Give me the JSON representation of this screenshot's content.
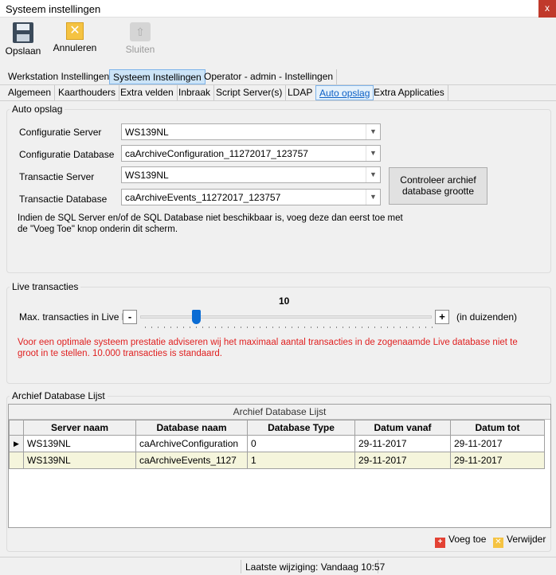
{
  "window": {
    "title": "Systeem instellingen",
    "close_glyph": "x"
  },
  "toolbar": {
    "save": {
      "label": "Opslaan",
      "icon": "save-icon"
    },
    "cancel": {
      "label": "Annuleren",
      "icon": "cancel-icon"
    },
    "close": {
      "label": "Sluiten",
      "icon": "close-icon",
      "disabled": true
    }
  },
  "main_tabs": [
    "Werkstation Instellingen",
    "Systeem Instellingen",
    "Operator - admin - Instellingen"
  ],
  "main_tab_active": "Systeem Instellingen",
  "sub_tabs": [
    "Algemeen",
    "Kaarthouders",
    "Extra velden",
    "Inbraak",
    "Script Server(s)",
    "LDAP",
    "Auto opslag",
    "Extra Applicaties"
  ],
  "sub_tab_active": "Auto opslag",
  "auto_opslag": {
    "title": "Auto opslag",
    "config_server_label": "Configuratie Server",
    "config_server_value": "WS139NL",
    "config_db_label": "Configuratie Database",
    "config_db_value": "caArchiveConfiguration_11272017_123757",
    "trans_server_label": "Transactie Server",
    "trans_server_value": "WS139NL",
    "trans_db_label": "Transactie Database",
    "trans_db_value": "caArchiveEvents_11272017_123757",
    "check_button_line1": "Controleer archief",
    "check_button_line2": "database grootte",
    "info_line1": "Indien de SQL Server en/of de SQL Database niet beschikbaar is, voeg deze dan eerst toe met",
    "info_line2": "de \"Voeg Toe\" knop onderin dit scherm."
  },
  "live": {
    "title": "Live transacties",
    "label": "Max. transacties in Live DB:",
    "minus": "-",
    "plus": "+",
    "value": "10",
    "unit": "(in duizenden)",
    "slider_fraction": 0.19,
    "warn_line1": "Voor een optimale systeem prestatie adviseren wij het maximaal aantal transacties in de zogenaamde Live database niet te",
    "warn_line2": "groot in te stellen. 10.000 transacties is standaard."
  },
  "archive": {
    "group_title": "Archief Database Lijst",
    "caption": "Archief Database Lijst",
    "columns": [
      "Server naam",
      "Database naam",
      "Database Type",
      "Datum vanaf",
      "Datum tot"
    ],
    "rows": [
      [
        "WS139NL",
        "caArchiveConfiguration",
        "0",
        "29-11-2017",
        "29-11-2017"
      ],
      [
        "WS139NL",
        "caArchiveEvents_1127",
        "1",
        "29-11-2017",
        "29-11-2017"
      ]
    ],
    "current_row_marker": "▶",
    "add_label": "Voeg toe",
    "remove_label": "Verwijder"
  },
  "status": {
    "text": "Laatste wijziging: Vandaag 10:57"
  },
  "colors": {
    "accent": "#0a6cd4",
    "warning": "#e02020",
    "active_tab": "#cce4f7"
  }
}
